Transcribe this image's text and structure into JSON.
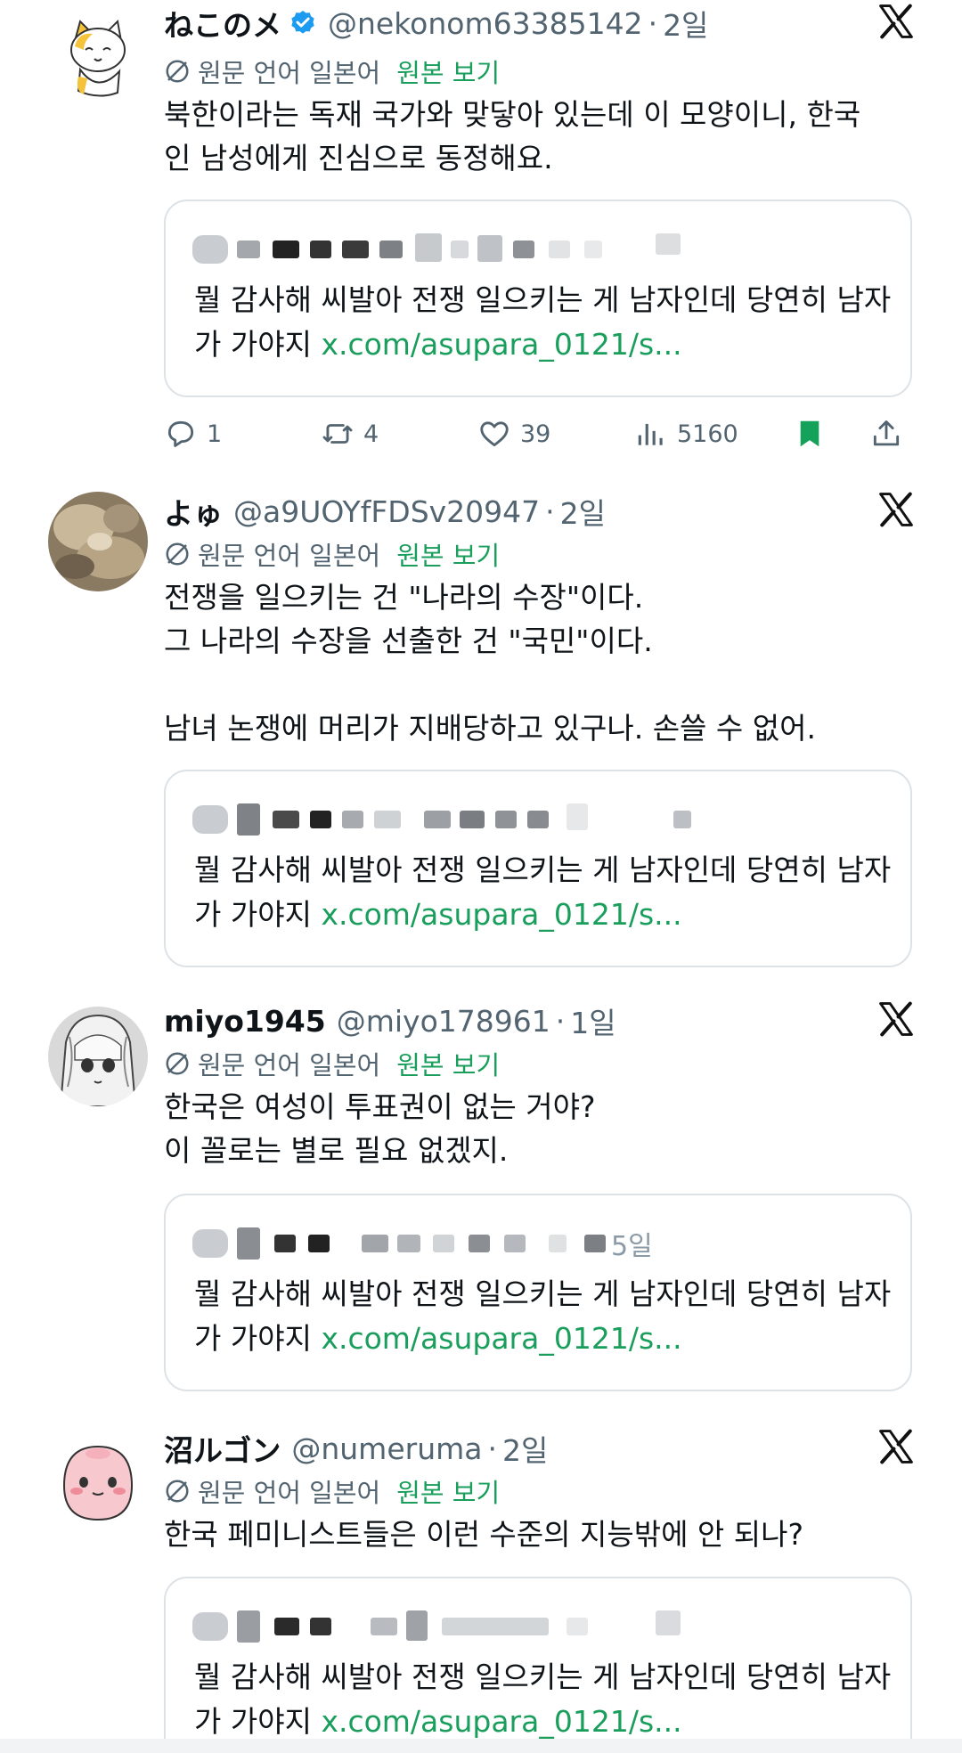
{
  "colors": {
    "accent_link": "#1a9e5c",
    "muted": "#536471",
    "bookmark": "#14a159",
    "verified": "#1d9bf0"
  },
  "translation": {
    "label": "원문 언어 일본어",
    "show_original": "원본 보기"
  },
  "quoted_tweet": {
    "text": "뭘 감사해 씨발아 전쟁 일으키는 게 남자인데 당연히 남자가 가야지",
    "link": "x.com/asupara_0121/s..."
  },
  "posts": [
    {
      "name": "ねこのメ",
      "verified": true,
      "handle": "@nekonom63385142",
      "separator": "·",
      "time": "2일",
      "text_lines": [
        "북한이라는 독재 국가와 맞닿아 있는데 이 모양이니, 한국",
        "인 남성에게 진심으로 동정해요."
      ],
      "actions": {
        "replies": "1",
        "retweets": "4",
        "likes": "39",
        "views": "5160",
        "bookmarked": true
      }
    },
    {
      "name": "よゅ",
      "verified": false,
      "handle": "@a9UOYfFDSv20947",
      "separator": "·",
      "time": "2일",
      "text_lines": [
        "전쟁을 일으키는 건 \"나라의 수장\"이다.",
        "그 나라의 수장을 선출한 건 \"국민\"이다.",
        "",
        "남녀 논쟁에 머리가 지배당하고 있구나. 손쓸 수 없어."
      ]
    },
    {
      "name": "miyo1945",
      "verified": false,
      "handle": "@miyo178961",
      "separator": "·",
      "time": "1일",
      "text_lines": [
        "한국은 여성이 투표권이 없는 거야?",
        "이 꼴로는 별로 필요 없겠지."
      ],
      "quote_date": "5일"
    },
    {
      "name": "沼ルゴン",
      "verified": false,
      "handle": "@numeruma",
      "separator": "·",
      "time": "2일",
      "text_lines": [
        "한국 페미니스트들은 이런 수준의 지능밖에 안 되나?"
      ]
    }
  ]
}
